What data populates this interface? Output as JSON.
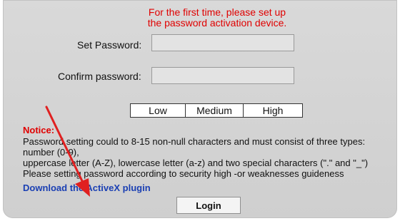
{
  "header": {
    "line1": "For the first time, please set up",
    "line2": "the password activation device."
  },
  "form": {
    "set_password_label": "Set Password:",
    "set_password_value": "",
    "confirm_password_label": "Confirm password:",
    "confirm_password_value": ""
  },
  "strength": {
    "low": "Low",
    "medium": "Medium",
    "high": "High"
  },
  "notice": {
    "title": "Notice:",
    "lines": [
      "Password setting could to 8-15 non-null characters and must consist of three types:",
      "number (0-9),",
      "uppercase letter (A-Z), lowercase letter (a-z) and two special characters (\".\" and \"_\")",
      "Please setting password according to security high -or weaknesses guideness"
    ]
  },
  "links": {
    "download_activex": "Download the ActiveX plugin"
  },
  "buttons": {
    "login": "Login"
  },
  "colors": {
    "panel_bg": "#d3d3d3",
    "warning_red": "#e00000",
    "link_blue": "#1a3fb3",
    "annotation_arrow": "#e02020"
  }
}
